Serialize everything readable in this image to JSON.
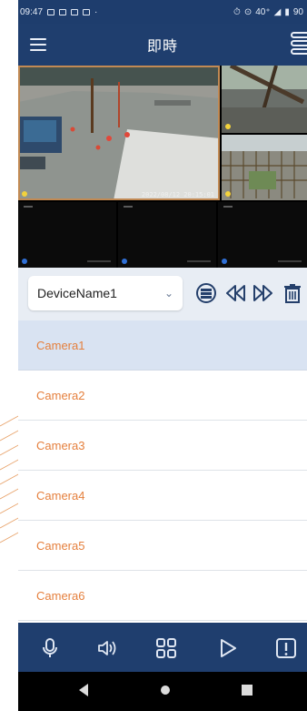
{
  "status_bar": {
    "time": "09:47",
    "right_text": "40⁺",
    "battery": "90"
  },
  "app_bar": {
    "title": "即時"
  },
  "camera_grid": {
    "tiles": [
      {
        "id": "cam-1",
        "timestamp": "2022/08/12 20:15:01",
        "dot_color": "#f2d23c",
        "selected": true
      },
      {
        "id": "cam-2",
        "timestamp": "",
        "dot_color": "#f2d23c",
        "selected": false
      },
      {
        "id": "cam-3",
        "timestamp": "",
        "dot_color": "#f2d23c",
        "selected": false
      },
      {
        "id": "cam-4",
        "timestamp": "",
        "dot_color": "#2f6fd6",
        "selected": false
      },
      {
        "id": "cam-5",
        "timestamp": "",
        "dot_color": "#2f6fd6",
        "selected": false
      },
      {
        "id": "cam-6",
        "timestamp": "",
        "dot_color": "#2f6fd6",
        "selected": false
      }
    ]
  },
  "device_control": {
    "selected_device": "DeviceName1",
    "icons": [
      "server-stack-icon",
      "rewind-icon",
      "fast-forward-icon",
      "trash-icon"
    ]
  },
  "camera_list": [
    {
      "label": "Camera1",
      "active": true
    },
    {
      "label": "Camera2",
      "active": false
    },
    {
      "label": "Camera3",
      "active": false
    },
    {
      "label": "Camera4",
      "active": false
    },
    {
      "label": "Camera5",
      "active": false
    },
    {
      "label": "Camera6",
      "active": false
    }
  ],
  "bottom_bar": {
    "icons": [
      "microphone-icon",
      "speaker-icon",
      "grid-layout-icon",
      "play-icon",
      "alert-icon"
    ]
  },
  "nav_bar": {
    "icons": [
      "back-icon",
      "home-icon",
      "recents-icon"
    ]
  },
  "colors": {
    "primary_navy": "#1f3e6e",
    "accent_orange": "#e57f3c",
    "active_row": "#d9e3f2",
    "control_bg": "#e8edf4"
  }
}
